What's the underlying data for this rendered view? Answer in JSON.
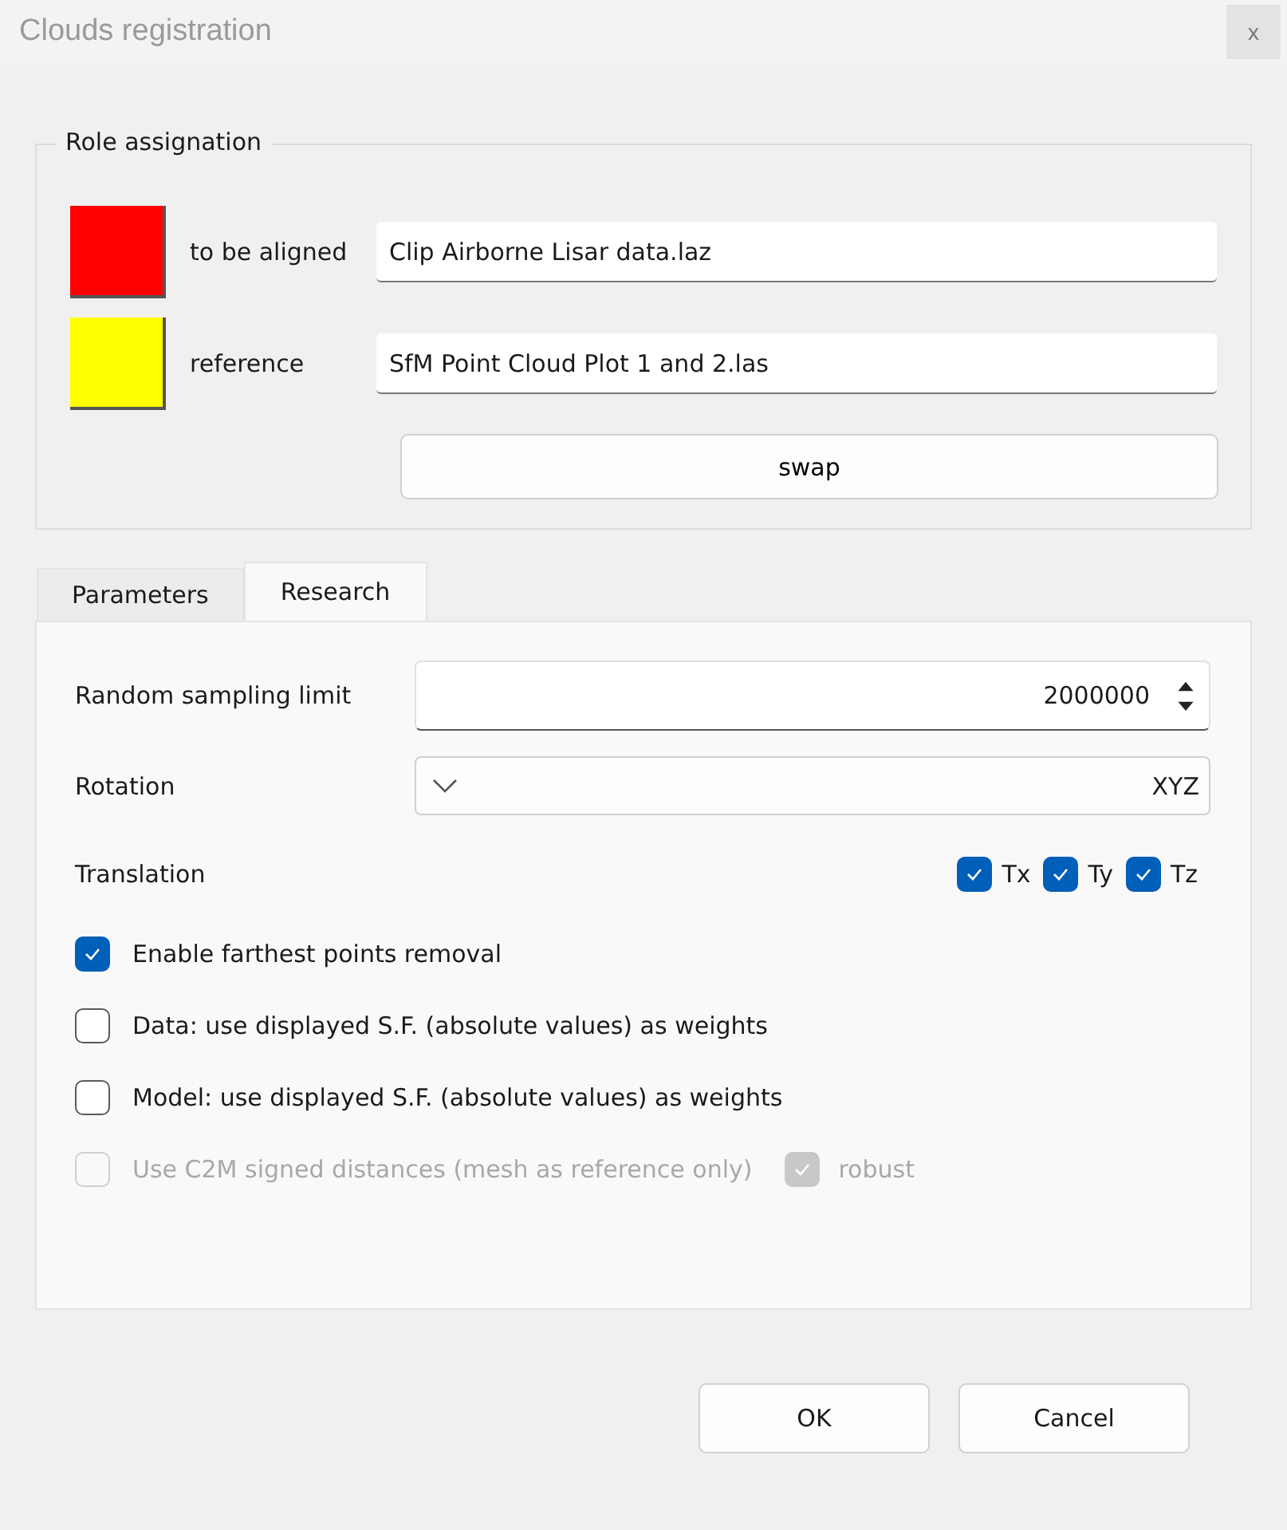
{
  "window": {
    "title": "Clouds registration",
    "close": "x"
  },
  "role_assignation": {
    "title": "Role assignation",
    "roles": [
      {
        "color": "#ff0000",
        "label": "to be aligned",
        "value": "Clip Airborne Lisar data.laz"
      },
      {
        "color": "#ffff00",
        "label": "reference",
        "value": "SfM Point Cloud Plot 1 and 2.las"
      }
    ],
    "swap_button": "swap"
  },
  "tabs": [
    {
      "label": "Parameters",
      "selected": false
    },
    {
      "label": "Research",
      "selected": true
    }
  ],
  "research": {
    "sampling": {
      "label": "Random sampling limit",
      "value": "2000000"
    },
    "rotation": {
      "label": "Rotation",
      "value": "XYZ"
    },
    "translation": {
      "label": "Translation",
      "axes": [
        {
          "label": "Tx",
          "checked": true
        },
        {
          "label": "Ty",
          "checked": true
        },
        {
          "label": "Tz",
          "checked": true
        }
      ]
    },
    "options": [
      {
        "label": "Enable farthest points removal",
        "checked": true,
        "disabled": false
      },
      {
        "label": "Data: use displayed S.F. (absolute values) as weights",
        "checked": false,
        "disabled": false
      },
      {
        "label": "Model: use displayed S.F. (absolute values) as weights",
        "checked": false,
        "disabled": false
      },
      {
        "label": "Use C2M signed distances (mesh as reference only)",
        "checked": false,
        "disabled": true,
        "extra": {
          "label": "robust",
          "checked": true,
          "disabled": true
        }
      }
    ]
  },
  "buttons": [
    "OK",
    "Cancel"
  ]
}
